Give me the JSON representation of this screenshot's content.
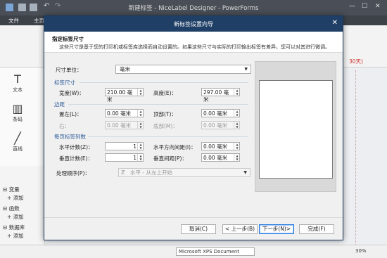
{
  "app": {
    "title": "新建标签 - NiceLabel Designer - PowerForms",
    "ribbon_tabs": [
      "文件",
      "主页"
    ],
    "minimize": "—",
    "maximize": "☐",
    "close": "✕"
  },
  "toolbox": {
    "items": [
      {
        "glyph": "T",
        "label": "文本"
      },
      {
        "glyph": "▥",
        "label": "条码"
      },
      {
        "glyph": "╱",
        "label": "直线"
      }
    ]
  },
  "variables_panel": {
    "items": [
      {
        "prefix": "⊟",
        "label": "变量"
      },
      {
        "prefix": "+",
        "label": "添加"
      },
      {
        "prefix": "⊟",
        "label": "函数"
      },
      {
        "prefix": "+",
        "label": "添加"
      },
      {
        "prefix": "⊟",
        "label": "数据库"
      },
      {
        "prefix": "+",
        "label": "添加"
      }
    ]
  },
  "background": {
    "red_text": "30天)"
  },
  "statusbar": {
    "printer": "Microsoft XPS Document",
    "zoom": "30%"
  },
  "dialog": {
    "title": "新标签设置向导",
    "close": "✕",
    "header_title": "指定标签尺寸",
    "header_desc": "这些尺寸是基于您的打印机或标签库选择而自动设置的。如果这些尺寸与实际的打印输出标签有差异，您可以对其进行微调。",
    "unit_label": "尺寸单位：",
    "unit_value": "毫米",
    "section_label_size": "标签尺寸",
    "width_label": "宽度(W)：",
    "width_value": "210.00 毫米",
    "height_label": "高度(E)：",
    "height_value": "297.00 毫米",
    "section_margins": "边距",
    "left_margin_label": "置左(L)：",
    "left_margin_value": "0.00 毫米",
    "top_margin_label": "顶部(T)：",
    "top_margin_value": "0.00 毫米",
    "right_margin_label": "右：",
    "right_margin_value": "0.00 毫米",
    "bottom_margin_label": "底部(M)：",
    "bottom_margin_value": "0.00 毫米",
    "section_labels_per_page": "每页标签列数",
    "horizontal_count_label": "水平计数(Z)：",
    "horizontal_count_value": "1",
    "horizontal_gap_label": "水平方向间距(I)：",
    "horizontal_gap_value": "0.00 毫米",
    "vertical_count_label": "垂直计数(E)：",
    "vertical_count_value": "1",
    "vertical_gap_label": "垂直间距(P)：",
    "vertical_gap_value": "0.00 毫米",
    "order_label": "处理顺序(P)：",
    "order_value": "水平 - 从左上开始",
    "buttons": {
      "cancel": "取消(C)",
      "back": "< 上一步(B)",
      "next": "下一步(N)>",
      "finish": "完成(F)"
    }
  },
  "colors": {
    "dialog_title_bg": "#1f3f66",
    "section_text": "#2c5b9a",
    "app_titlebar": "#4a4f57"
  }
}
